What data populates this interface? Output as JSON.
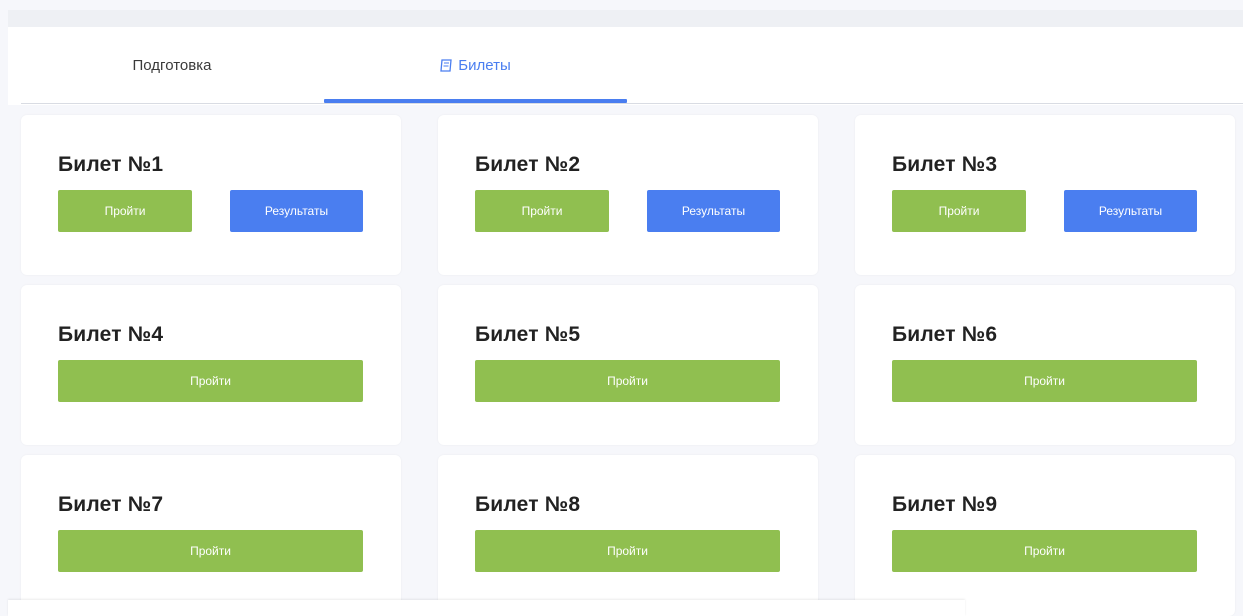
{
  "tabs": [
    {
      "label": "Подготовка",
      "active": false
    },
    {
      "label": "Билеты",
      "active": true,
      "icon": "book-icon"
    }
  ],
  "colors": {
    "accent": "#4a7ef0",
    "go": "#90bf50"
  },
  "tickets": [
    {
      "title": "Билет №1",
      "go": "Пройти",
      "results": "Результаты"
    },
    {
      "title": "Билет №2",
      "go": "Пройти",
      "results": "Результаты"
    },
    {
      "title": "Билет №3",
      "go": "Пройти",
      "results": "Результаты"
    },
    {
      "title": "Билет №4",
      "go": "Пройти"
    },
    {
      "title": "Билет №5",
      "go": "Пройти"
    },
    {
      "title": "Билет №6",
      "go": "Пройти"
    },
    {
      "title": "Билет №7",
      "go": "Пройти"
    },
    {
      "title": "Билет №8",
      "go": "Пройти"
    },
    {
      "title": "Билет №9",
      "go": "Пройти"
    }
  ]
}
